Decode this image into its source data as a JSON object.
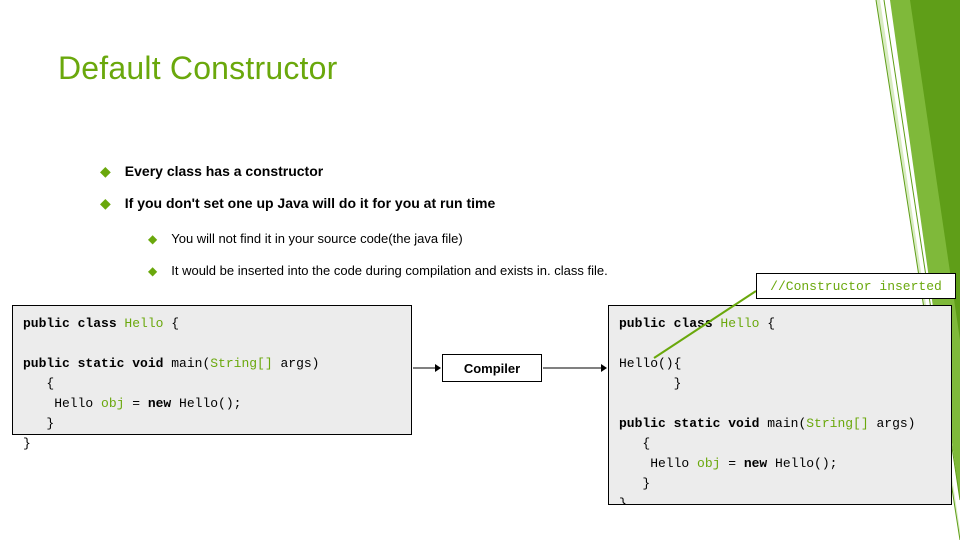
{
  "title": "Default Constructor",
  "bullets": {
    "b1": "Every class has a constructor",
    "b2": "If you don't set one up Java will do it for you at run time",
    "s1": "You will not find it in your source code(the java file)",
    "s2": "It would be inserted into the code during compilation and exists in. class file."
  },
  "compiler_label": "Compiler",
  "annot": "//Constructor inserted",
  "code_left": {
    "l1a": "public class ",
    "l1b": "Hello",
    "l1c": " {",
    "l2": "",
    "l3a": "public static void ",
    "l3b": "main(",
    "l3c": "String[]",
    "l3d": " args)",
    "l4": "   {",
    "l5a": "    Hello ",
    "l5b": "obj",
    "l5c": " = ",
    "l5d": "new ",
    "l5e": "Hello();",
    "l6": "   }",
    "l7": "}"
  },
  "code_right": {
    "l1a": "public class ",
    "l1b": "Hello",
    "l1c": " {",
    "l2": "",
    "l3": "Hello(){",
    "l4": "       }",
    "l5": "",
    "l6a": "public static void ",
    "l6b": "main(",
    "l6c": "String[]",
    "l6d": " args)",
    "l7": "   {",
    "l8a": "    Hello ",
    "l8b": "obj",
    "l8c": " = ",
    "l8d": "new ",
    "l8e": "Hello();",
    "l9": "   }",
    "l10": "}"
  }
}
